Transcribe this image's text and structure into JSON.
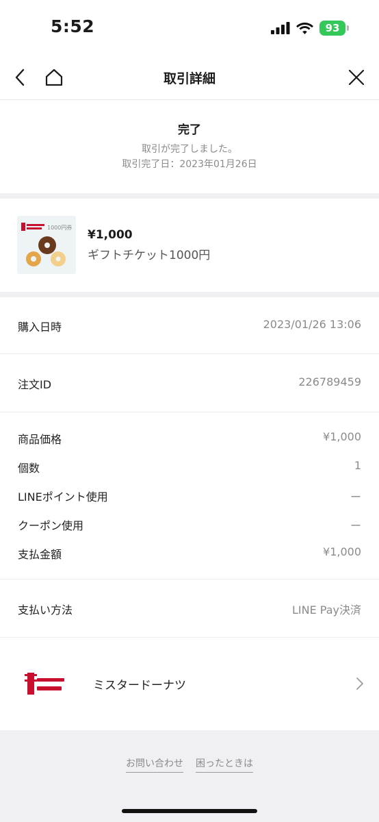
{
  "status_bar": {
    "time": "5:52",
    "battery": "93"
  },
  "header": {
    "title": "取引詳細"
  },
  "transaction_status": {
    "heading": "完了",
    "message": "取引が完了しました。",
    "date": "取引完了日：2023年01月26日"
  },
  "product": {
    "price": "¥1,000",
    "name": "ギフトチケット1000円",
    "thumbnail_text": "1000円券"
  },
  "details": {
    "purchase_datetime": {
      "label": "購入日時",
      "value": "2023/01/26 13:06"
    },
    "order_id": {
      "label": "注文ID",
      "value": "226789459"
    },
    "item_price": {
      "label": "商品価格",
      "value": "¥1,000"
    },
    "quantity": {
      "label": "個数",
      "value": "1"
    },
    "line_points": {
      "label": "LINEポイント使用",
      "value": "ー"
    },
    "coupon": {
      "label": "クーポン使用",
      "value": "ー"
    },
    "total": {
      "label": "支払金額",
      "value": "¥1,000"
    },
    "payment_method": {
      "label": "支払い方法",
      "value": "LINE Pay決済"
    }
  },
  "store": {
    "name": "ミスタードーナツ"
  },
  "footer": {
    "contact": "お問い合わせ",
    "help": "困ったときは"
  },
  "colors": {
    "battery": "#34c759",
    "muted_text": "#8a8a8a",
    "section_gap": "#f0f0f4",
    "brand_red": "#c8102e"
  }
}
